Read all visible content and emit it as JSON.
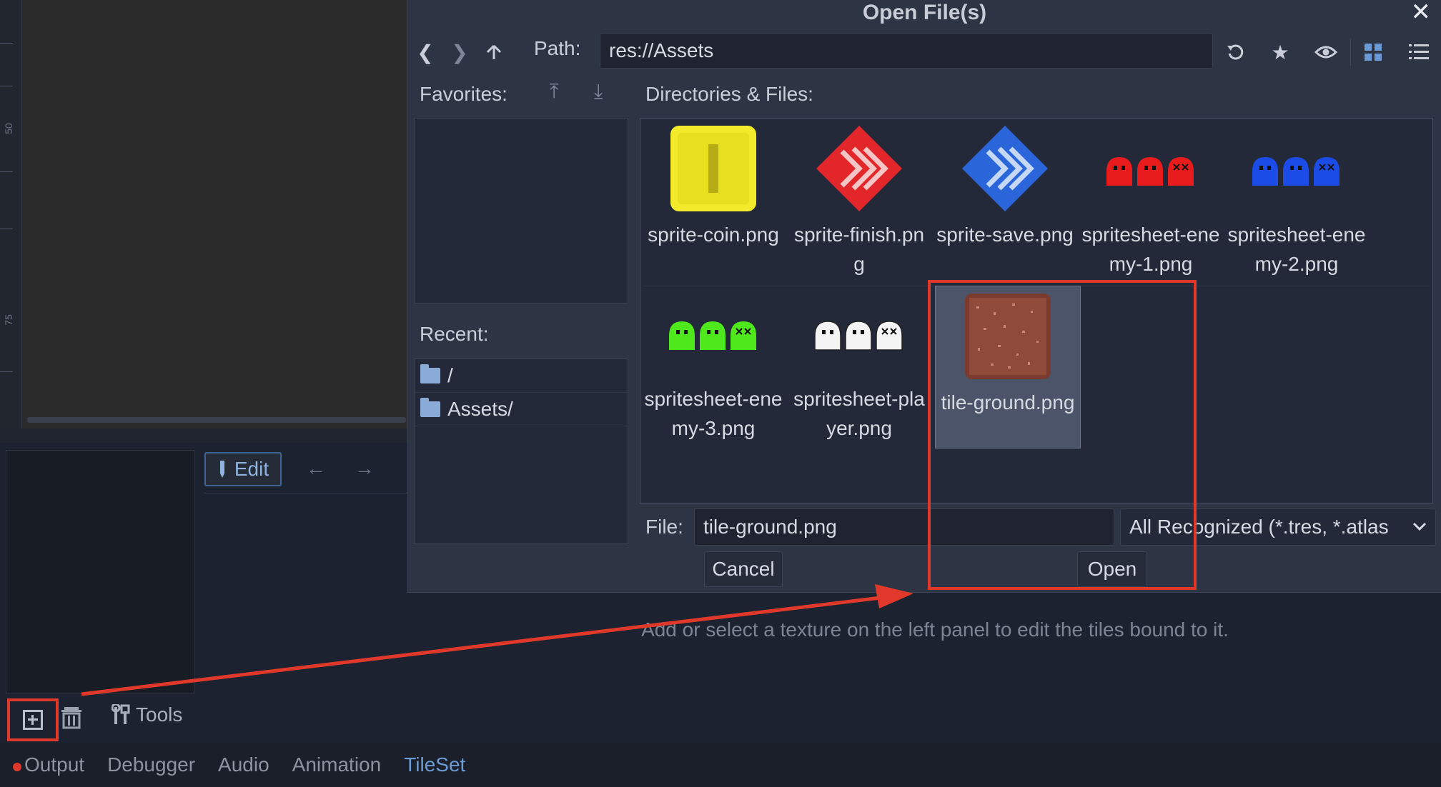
{
  "dialog": {
    "title": "Open File(s)",
    "path_label": "Path:",
    "path_value": "res://Assets",
    "favorites_label": "Favorites:",
    "recent_label": "Recent:",
    "recent_items": [
      "/",
      "Assets/"
    ],
    "dirs_label": "Directories & Files:",
    "files": [
      {
        "name": "sprite-coin.png",
        "icon": "coin-thumbnail"
      },
      {
        "name": "sprite-finish.png",
        "icon": "finish-thumbnail"
      },
      {
        "name": "sprite-save.png",
        "icon": "save-thumbnail"
      },
      {
        "name": "spritesheet-enemy-1.png",
        "icon": "red-ghosts-thumbnail"
      },
      {
        "name": "spritesheet-enemy-2.png",
        "icon": "blue-ghosts-thumbnail"
      },
      {
        "name": "spritesheet-enemy-3.png",
        "icon": "green-ghosts-thumbnail"
      },
      {
        "name": "spritesheet-player.png",
        "icon": "white-ghosts-thumbnail"
      },
      {
        "name": "tile-ground.png",
        "icon": "ground-tile-thumbnail",
        "selected": true
      }
    ],
    "file_label": "File:",
    "file_value": "tile-ground.png",
    "filter_value": "All Recognized (*.tres, *.atlas",
    "cancel_label": "Cancel",
    "open_label": "Open"
  },
  "editor": {
    "edit_label": "Edit",
    "hint": "Add or select a texture on the left panel to edit the tiles bound to it.",
    "tools_label": "Tools",
    "ruler_marks": [
      "50",
      "75"
    ]
  },
  "bottom_tabs": [
    "Output",
    "Debugger",
    "Audio",
    "Animation",
    "TileSet"
  ],
  "active_tab": "TileSet",
  "colors": {
    "accent": "#6b9bd6",
    "highlight": "#e0392b",
    "dialog_bg": "#2d3444"
  }
}
